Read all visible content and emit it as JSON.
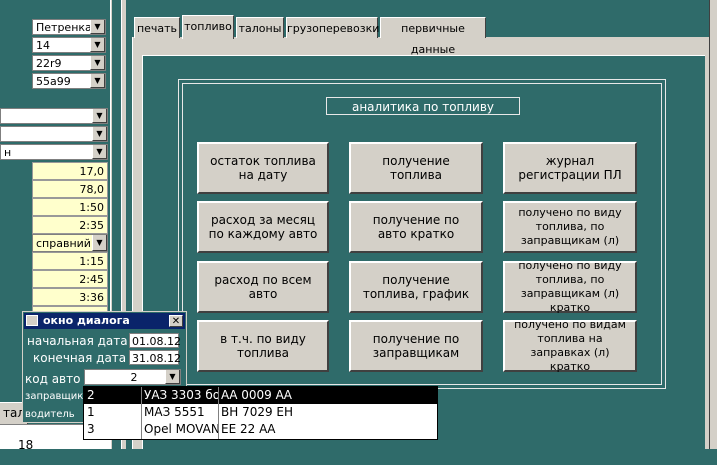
{
  "left_panel": {
    "combos_top": [
      "Петренка",
      "14",
      "22r9",
      "55a99"
    ],
    "combos_mid": [
      "",
      "",
      "н"
    ],
    "yellow_values": [
      "17,0",
      "78,0",
      "1:50",
      "2:35",
      "справний",
      "1:15",
      "2:45",
      "3:36"
    ],
    "bottom_tab": "тал",
    "bottom_value": "18"
  },
  "tabs": [
    "печать",
    "топливо",
    "талоны",
    "грузоперевозки",
    "первичные данные"
  ],
  "panel_title": "аналитика по топливу",
  "buttons": {
    "col1": [
      "остаток топлива на дату",
      "расход за месяц по каждому авто",
      "расход по всем авто",
      "в т.ч. по виду топлива"
    ],
    "col2": [
      "получение топлива",
      "получение по авто кратко",
      "получение топлива, график",
      "получение по заправщикам"
    ],
    "col3": [
      "журнал регистрации ПЛ",
      "получено по виду топлива,  по заправщикам (л)",
      "получено по виду топлива,  по заправщикам (л) кратко",
      "получено по видам топлива на заправках (л) кратко"
    ]
  },
  "dialog": {
    "title": "окно диалога",
    "start_label": "начальная дата",
    "start_value": "01.08.12",
    "end_label": "конечная дата",
    "end_value": "31.08.12",
    "car_label": "код авто",
    "car_value": "2",
    "station_label": "заправщик",
    "driver_label": "водитель"
  },
  "dropdown": {
    "rows": [
      [
        "2",
        "УАЗ 3303 бо",
        "АА 0009 АА"
      ],
      [
        "1",
        "МАЗ 5551",
        "ВН 7029 ЕН"
      ],
      [
        "3",
        "Opel MOVAN",
        "ЕЕ 22 АА"
      ]
    ]
  },
  "colors": {
    "teal": "#2f6b6a",
    "form": "#d4d0c8",
    "highlight": "#000000",
    "dialog_title": "#0a246a"
  }
}
